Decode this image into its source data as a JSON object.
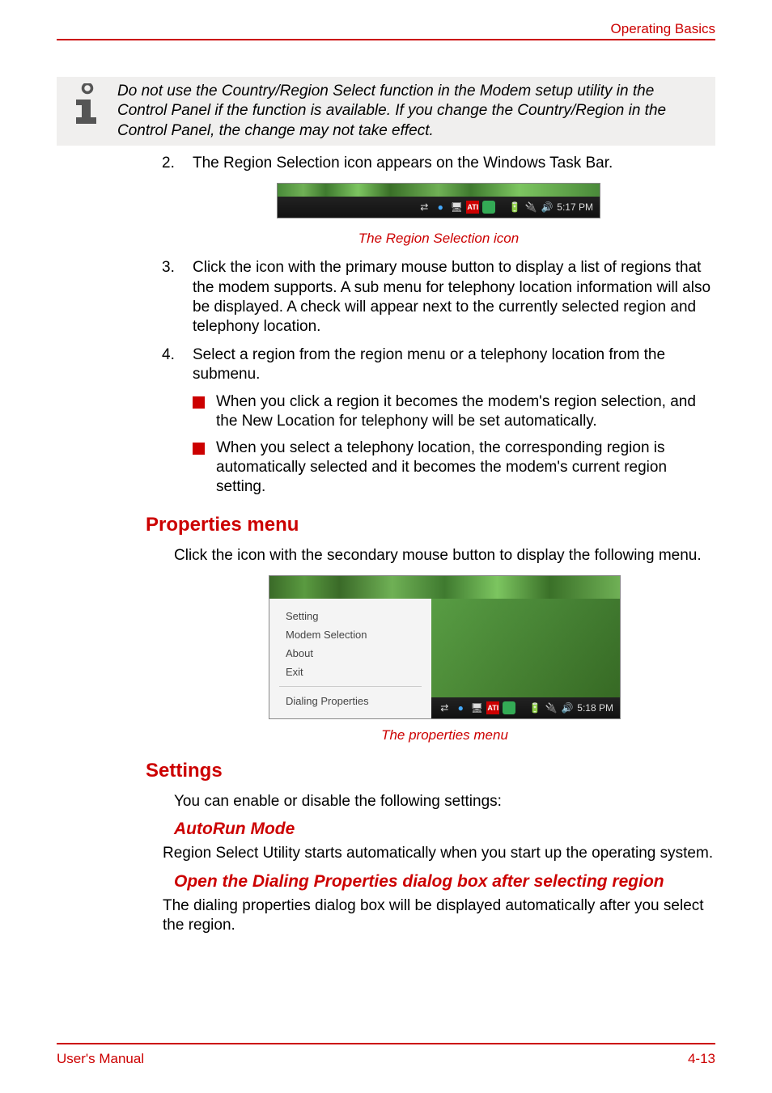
{
  "header": {
    "title": "Operating Basics"
  },
  "note": {
    "text": "Do not use the Country/Region Select function in the Modem setup utility in the Control Panel if the function is available. If you change the Country/Region in the Control Panel, the change may not take effect."
  },
  "steps": {
    "s2_num": "2.",
    "s2_text": "The Region Selection icon appears on the Windows Task Bar.",
    "fig1_caption": "The Region Selection icon",
    "fig1_time": "5:17 PM",
    "s3_num": "3.",
    "s3_text": "Click the icon with the primary mouse button to display a list of regions that the modem supports. A sub menu for telephony location information will also be displayed. A check will appear next to the currently selected region and telephony location.",
    "s4_num": "4.",
    "s4_text": "Select a region from the region menu or a telephony location from the submenu.",
    "s4_b1": "When you click a region it becomes the modem's region selection, and the New Location for telephony will be set automatically.",
    "s4_b2": "When you select a telephony location, the corresponding region is automatically selected and it becomes the modem's current region setting."
  },
  "properties_menu": {
    "heading": "Properties menu",
    "intro": "Click the icon with the secondary mouse button to display the following menu.",
    "menu_items": {
      "setting": "Setting",
      "modem": "Modem Selection",
      "about": "About",
      "exit": "Exit",
      "dialing": "Dialing Properties"
    },
    "fig2_caption": "The properties menu",
    "fig2_time": "5:18 PM"
  },
  "settings": {
    "heading": "Settings",
    "intro": "You can enable or disable the following settings:",
    "autorun_h": "AutoRun Mode",
    "autorun_p": "Region Select Utility starts automatically when you start up the operating system.",
    "open_h": "Open the Dialing Properties dialog box after selecting region",
    "open_p": "The dialing properties dialog box will be displayed automatically after you select the region."
  },
  "footer": {
    "left": "User's Manual",
    "right": "4-13"
  },
  "tray_icons": [
    "connect-icon",
    "info-icon",
    "monitor-icon",
    "ati-icon",
    "flag-icon",
    "battery-icon",
    "power-icon",
    "volume-icon"
  ]
}
